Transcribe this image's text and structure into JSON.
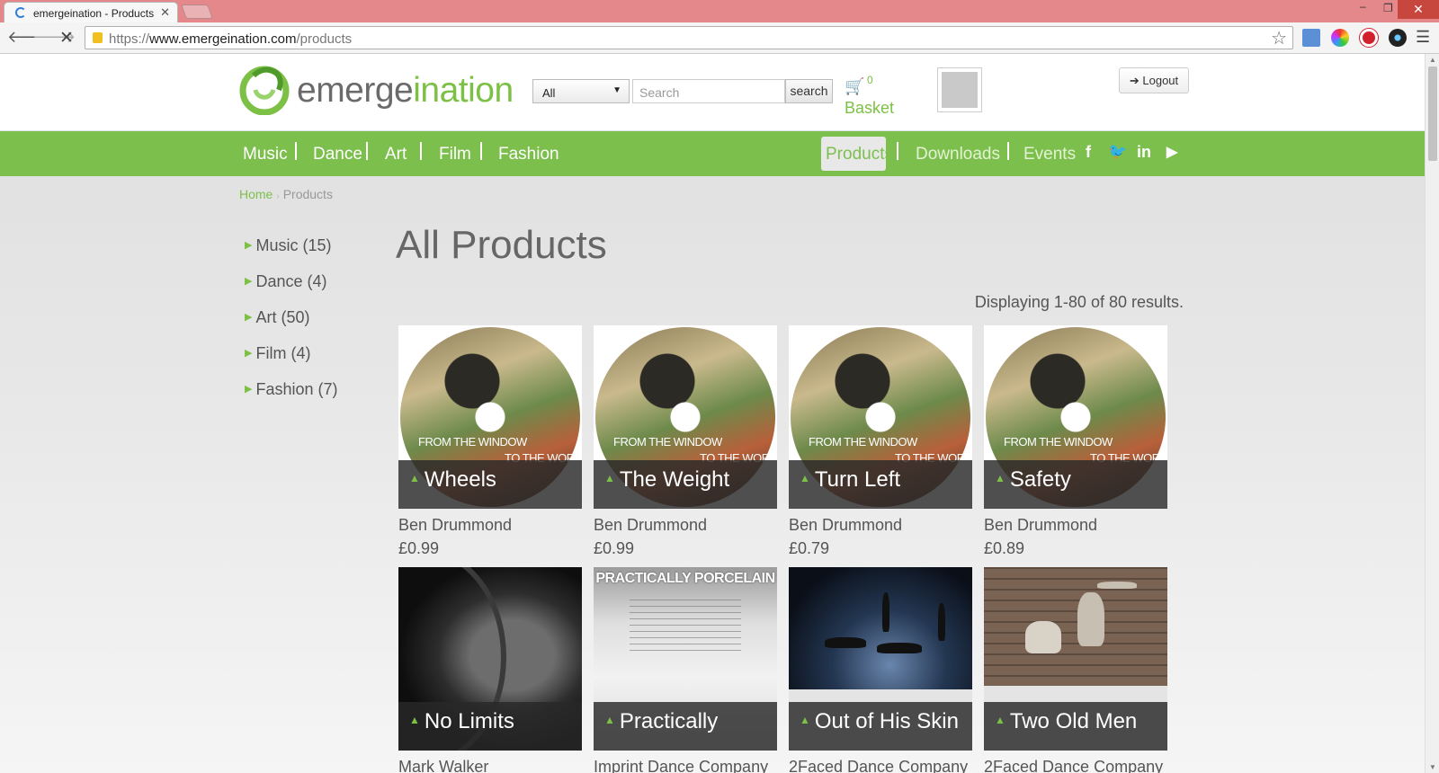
{
  "browser": {
    "tab_title": "emergeination - Products",
    "url_scheme": "https://",
    "url_host": "www.emergeination.com",
    "url_path": "/products"
  },
  "header": {
    "logo_part1": "emerge",
    "logo_part2": "ination",
    "search_category": "All",
    "search_placeholder": "Search",
    "search_button": "search",
    "basket_count": "0",
    "basket_label": "Basket",
    "logout_label": "Logout"
  },
  "nav": {
    "left": [
      "Music",
      "Dance",
      "Art",
      "Film",
      "Fashion"
    ],
    "active": "Products",
    "right": [
      "Downloads",
      "Events"
    ]
  },
  "breadcrumb": {
    "home": "Home",
    "current": "Products"
  },
  "categories": [
    "Music (15)",
    "Dance (4)",
    "Art (50)",
    "Film (4)",
    "Fashion (7)"
  ],
  "main": {
    "title": "All Products",
    "results_text": "Displaying 1-80 of 80 results."
  },
  "cd_text": {
    "line1": "FROM THE WINDOW",
    "line2": "TO THE WORLD"
  },
  "porcelain_title": "PRACTICALLY PORCELAIN",
  "products": [
    {
      "name": "Wheels",
      "artist": "Ben Drummond",
      "price": "£0.99"
    },
    {
      "name": "The Weight",
      "artist": "Ben Drummond",
      "price": "£0.99"
    },
    {
      "name": "Turn Left",
      "artist": "Ben Drummond",
      "price": "£0.79"
    },
    {
      "name": "Safety",
      "artist": "Ben Drummond",
      "price": "£0.89"
    },
    {
      "name": "No Limits",
      "artist": "Mark Walker",
      "price": ""
    },
    {
      "name": "Practically",
      "artist": "Imprint Dance Company",
      "price": ""
    },
    {
      "name": "Out of His Skin",
      "artist": "2Faced Dance Company",
      "price": ""
    },
    {
      "name": "Two Old Men",
      "artist": "2Faced Dance Company",
      "price": ""
    }
  ],
  "colors": {
    "brand_green": "#7dbf4d",
    "title_bar": "#e5888c"
  }
}
